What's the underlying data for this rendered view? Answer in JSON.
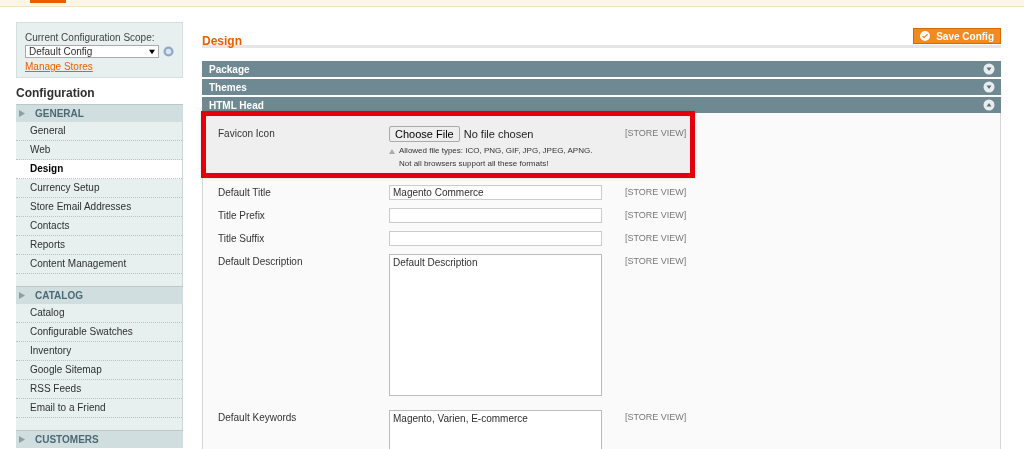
{
  "scope": {
    "label": "Current Configuration Scope:",
    "value": "Default Config",
    "link": "Manage Stores"
  },
  "sidebar": {
    "title": "Configuration",
    "groups": [
      {
        "label": "GENERAL",
        "items": [
          {
            "label": "General",
            "selected": false
          },
          {
            "label": "Web",
            "selected": false
          },
          {
            "label": "Design",
            "selected": true
          },
          {
            "label": "Currency Setup",
            "selected": false
          },
          {
            "label": "Store Email Addresses",
            "selected": false
          },
          {
            "label": "Contacts",
            "selected": false
          },
          {
            "label": "Reports",
            "selected": false
          },
          {
            "label": "Content Management",
            "selected": false
          }
        ]
      },
      {
        "label": "CATALOG",
        "items": [
          {
            "label": "Catalog",
            "selected": false
          },
          {
            "label": "Configurable Swatches",
            "selected": false
          },
          {
            "label": "Inventory",
            "selected": false
          },
          {
            "label": "Google Sitemap",
            "selected": false
          },
          {
            "label": "RSS Feeds",
            "selected": false
          },
          {
            "label": "Email to a Friend",
            "selected": false
          }
        ]
      },
      {
        "label": "CUSTOMERS"
      }
    ]
  },
  "page": {
    "title": "Design",
    "save_button": "Save Config"
  },
  "sections": [
    {
      "title": "Package",
      "expanded": false
    },
    {
      "title": "Themes",
      "expanded": false
    },
    {
      "title": "HTML Head",
      "expanded": true
    }
  ],
  "fields": [
    {
      "kind": "file",
      "label": "Favicon Icon",
      "button": "Choose File",
      "status": "No file chosen",
      "notes": [
        "Allowed file types: ICO, PNG, GIF, JPG, JPEG, APNG.",
        "Not all browsers support all these formats!"
      ],
      "scope": "[STORE VIEW]",
      "highlighted": true
    },
    {
      "kind": "text",
      "label": "Default Title",
      "value": "Magento Commerce",
      "scope": "[STORE VIEW]",
      "highlighted": false
    },
    {
      "kind": "text",
      "label": "Title Prefix",
      "scope": "[STORE VIEW]",
      "highlighted": false
    },
    {
      "kind": "text",
      "label": "Title Suffix",
      "scope": "[STORE VIEW]",
      "highlighted": false
    },
    {
      "kind": "textarea",
      "label": "Default Description",
      "value": "Default Description",
      "scope": "[STORE VIEW]",
      "highlighted": false
    },
    {
      "kind": "textarea",
      "label": "Default Keywords",
      "value": "Magento, Varien, E-commerce",
      "scope": "[STORE VIEW]",
      "highlighted": false
    }
  ]
}
